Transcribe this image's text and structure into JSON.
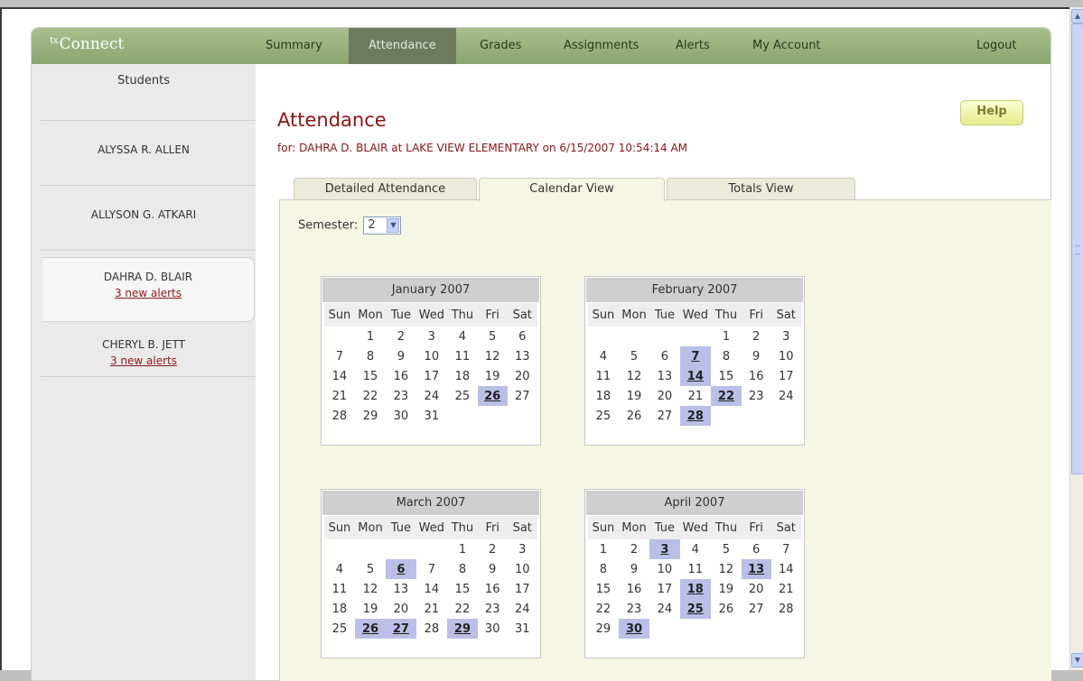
{
  "brand": {
    "logo_prefix": "tx",
    "logo_name": "Connect"
  },
  "nav": {
    "summary": "Summary",
    "attendance": "Attendance",
    "grades": "Grades",
    "assignments": "Assignments",
    "alerts": "Alerts",
    "my_account": "My Account",
    "logout": "Logout"
  },
  "sidebar": {
    "heading": "Students",
    "students": [
      {
        "name": "ALYSSA R. ALLEN",
        "alerts": ""
      },
      {
        "name": "ALLYSON G. ATKARI",
        "alerts": ""
      },
      {
        "name": "DAHRA D. BLAIR",
        "alerts": "3 new alerts"
      },
      {
        "name": "CHERYL B. JETT",
        "alerts": "3 new alerts"
      }
    ]
  },
  "main": {
    "help_label": "Help",
    "title": "Attendance",
    "subtitle": "for: DAHRA D. BLAIR at LAKE VIEW ELEMENTARY on 6/15/2007 10:54:14 AM",
    "tabs": [
      "Detailed Attendance",
      "Calendar View",
      "Totals View"
    ],
    "semester_label": "Semester:",
    "semester_value": "2"
  },
  "weekdays": [
    "Sun",
    "Mon",
    "Tue",
    "Wed",
    "Thu",
    "Fri",
    "Sat"
  ],
  "calendars": [
    {
      "title": "January 2007",
      "first_weekday": 1,
      "days": 31,
      "marked": [
        26
      ]
    },
    {
      "title": "February 2007",
      "first_weekday": 4,
      "days": 28,
      "marked": [
        7,
        14,
        22,
        28
      ]
    },
    {
      "title": "March 2007",
      "first_weekday": 4,
      "days": 31,
      "marked": [
        6,
        26,
        27,
        29
      ]
    },
    {
      "title": "April 2007",
      "first_weekday": 0,
      "days": 30,
      "marked": [
        3,
        13,
        18,
        25,
        30
      ]
    }
  ],
  "colors": {
    "accent": "#8b1414",
    "nav": "#8aa56e",
    "absence_mark": "#b9bfe6"
  }
}
